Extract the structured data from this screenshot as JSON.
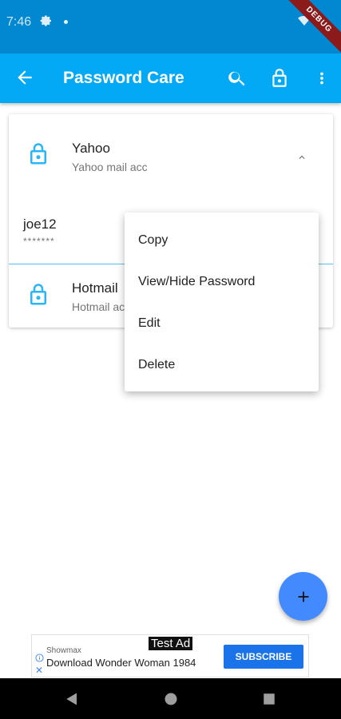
{
  "status": {
    "time": "7:46",
    "ribbon": "DEBUG"
  },
  "appbar": {
    "title": "Password Care"
  },
  "entries": [
    {
      "name": "Yahoo",
      "subtitle": "Yahoo mail acc",
      "username": "joe12",
      "password_masked": "*******"
    },
    {
      "name": "Hotmail",
      "subtitle": "Hotmail acc"
    }
  ],
  "menu": {
    "items": [
      "Copy",
      "View/Hide Password",
      "Edit",
      "Delete"
    ]
  },
  "ad": {
    "label": "Test Ad",
    "brand": "Showmax",
    "text": "Download Wonder Woman 1984",
    "button": "SUBSCRIBE"
  },
  "colors": {
    "status_bar": "#0288d1",
    "app_bar": "#03a9f4",
    "icon_blue": "#29b6f6",
    "fab": "#448aff"
  }
}
